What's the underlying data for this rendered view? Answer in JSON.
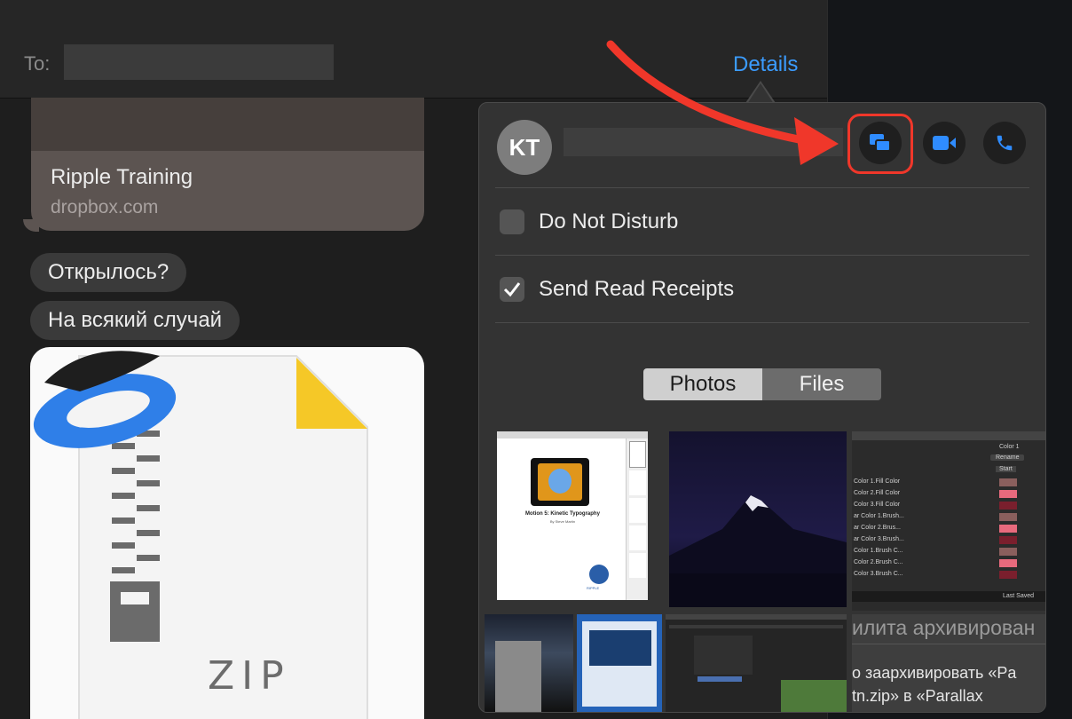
{
  "header": {
    "to_label": "To:",
    "details_label": "Details"
  },
  "link_preview": {
    "title": "Ripple Training",
    "url": "dropbox.com"
  },
  "messages": [
    {
      "text": "Открылось?"
    },
    {
      "text": "На всякий случай"
    }
  ],
  "attachment": {
    "type_label": "ZIP",
    "icon": "zip-archive-icon",
    "badge_icon": "yandex-disk-icon",
    "colors": {
      "badge": "#2f7fe8",
      "corner": "#f5c827"
    }
  },
  "details": {
    "avatar_initials": "KT",
    "actions": [
      {
        "icon": "screen-share-icon"
      },
      {
        "icon": "video-camera-icon"
      },
      {
        "icon": "phone-icon"
      }
    ],
    "do_not_disturb": {
      "label": "Do Not Disturb",
      "checked": false
    },
    "read_receipts": {
      "label": "Send Read Receipts",
      "checked": true
    },
    "tabs": [
      {
        "label": "Photos",
        "selected": true
      },
      {
        "label": "Files",
        "selected": false
      }
    ],
    "thumbnails": {
      "doc_title": "Motion 5: Kinetic Typography",
      "doc_author": "By Steve Martin",
      "doc_brand": "RIPPLE",
      "color_panel": {
        "dropdown": "Color 1",
        "rename": "Rename",
        "start": "Start",
        "rows": [
          "Color 1.Fill Color",
          "Color 2.Fill Color",
          "Color 3.Fill Color",
          "ar Color 1.Brush...",
          "ar Color 2.Brus...",
          "ar Color 3.Brush...",
          "Color 1.Brush C...",
          "Color 2.Brush C...",
          "Color 3.Brush C..."
        ],
        "footer": "Last Saved"
      },
      "archive_text": {
        "line1": "илита архивирован",
        "line2": "о заархивировать «Pa",
        "line3": "tn.zip» в «Parallax"
      }
    }
  },
  "annotation": {
    "arrow_color": "#f0372a"
  }
}
